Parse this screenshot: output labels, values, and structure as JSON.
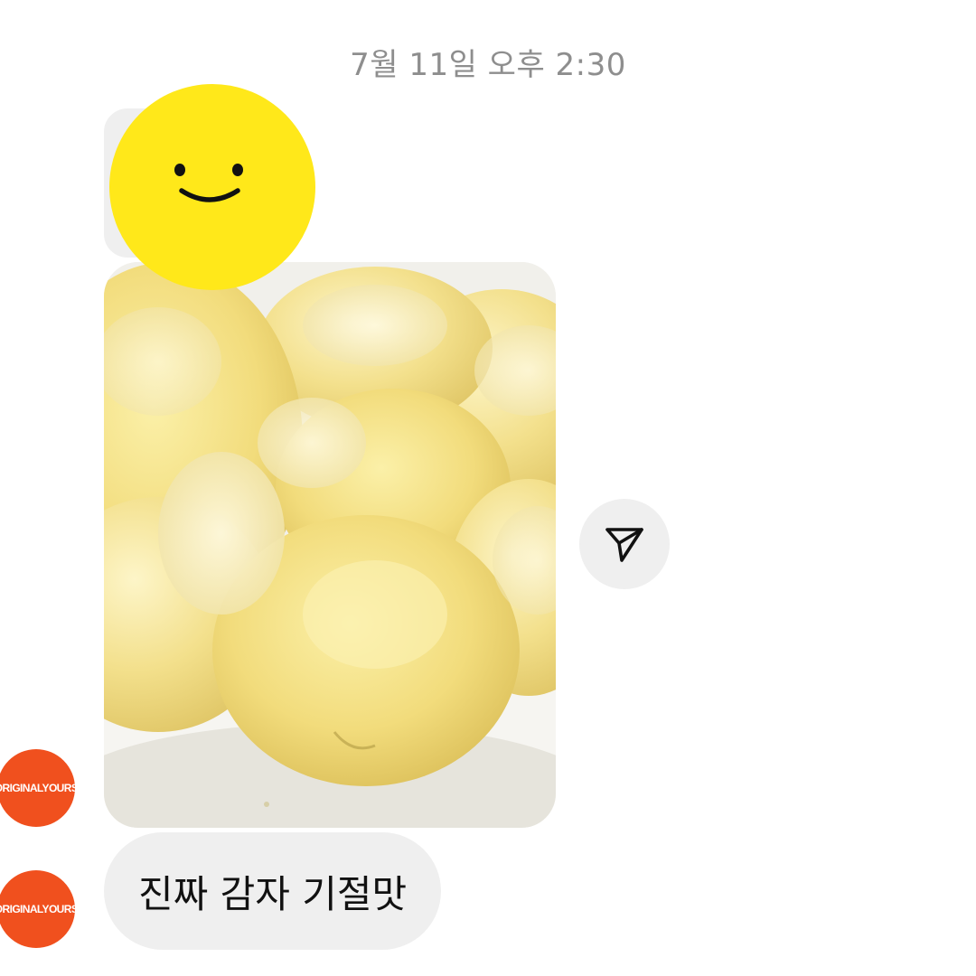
{
  "chat": {
    "timestamp": "7월 11일 오후 2:30",
    "sender": {
      "avatar_text": "ORIGINALYOURS",
      "avatar_color": "#f0501e"
    },
    "messages": [
      {
        "type": "sticker",
        "icon": "smiley-face-icon",
        "color": "#ffe81a"
      },
      {
        "type": "photo",
        "subject": "boiled-potatoes-photo"
      },
      {
        "type": "text",
        "text": "진짜 감자 기절맛"
      }
    ],
    "share_icon": "send-paper-plane-icon"
  }
}
